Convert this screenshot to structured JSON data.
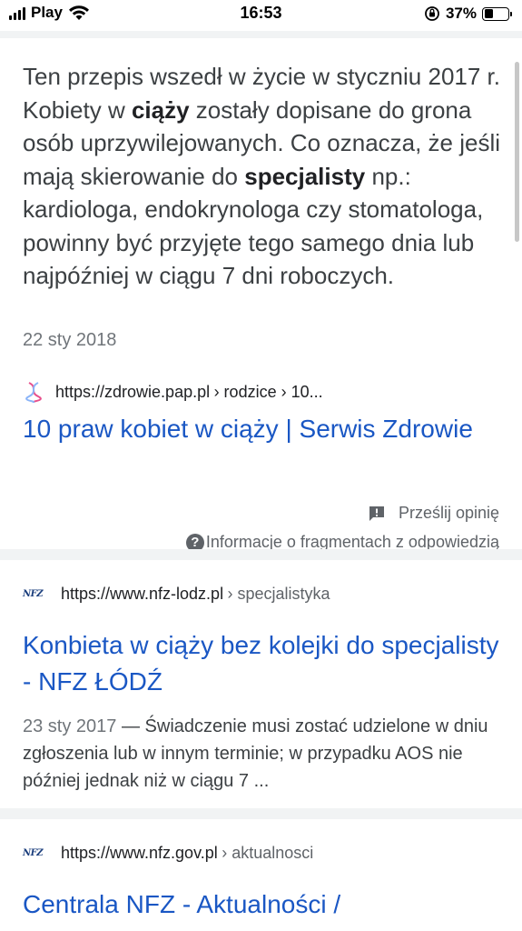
{
  "status_bar": {
    "carrier": "Play",
    "time": "16:53",
    "battery_percent": "37%",
    "battery_level": 0.37
  },
  "featured_snippet": {
    "text_parts": [
      {
        "text": "Ten przepis wszedł w życie w styczniu 2017 r. Kobiety w ",
        "bold": false
      },
      {
        "text": "ciąży",
        "bold": true
      },
      {
        "text": " zostały dopisane do grona osób uprzywilejowanych. Co oznacza, że jeśli mają skierowanie do ",
        "bold": false
      },
      {
        "text": "specjalisty",
        "bold": true
      },
      {
        "text": " np.: kardiologa, endokrynologa czy stomatologa, powinny być przyjęte tego samego dnia lub najpóźniej w ciągu 7 dni roboczych.",
        "bold": false
      }
    ],
    "date": "22 sty 2018",
    "source_url": "https://zdrowie.pap.pl",
    "source_path": "› rodzice › 10...",
    "title": "10 praw kobiet w ciąży | Serwis Zdrowie",
    "feedback_label": "Prześlij opinię",
    "info_label": "Informacje o fragmentach z odpowiedzią"
  },
  "results": [
    {
      "logo_text": "NFZ",
      "domain": "https://www.nfz-lodz.pl",
      "crumb": "› specjalistyka",
      "title": "Konbieta w ciąży bez kolejki do specjalisty - NFZ ŁÓDŹ",
      "date": "23 sty 2017",
      "snippet": " — Świadczenie musi zostać udzielone w dniu zgłoszenia lub w innym terminie; w przypadku AOS nie później jednak niż w ciągu 7 ..."
    },
    {
      "logo_text": "NFZ",
      "domain": "https://www.nfz.gov.pl",
      "crumb": "› aktualnosci",
      "title": "Centrala NFZ - Aktualności /"
    }
  ],
  "icons": {
    "signal": "signal-icon",
    "wifi": "wifi-icon",
    "rotation_lock": "rotation-lock-icon",
    "battery": "battery-icon",
    "feedback": "feedback-icon",
    "info": "help-icon"
  }
}
